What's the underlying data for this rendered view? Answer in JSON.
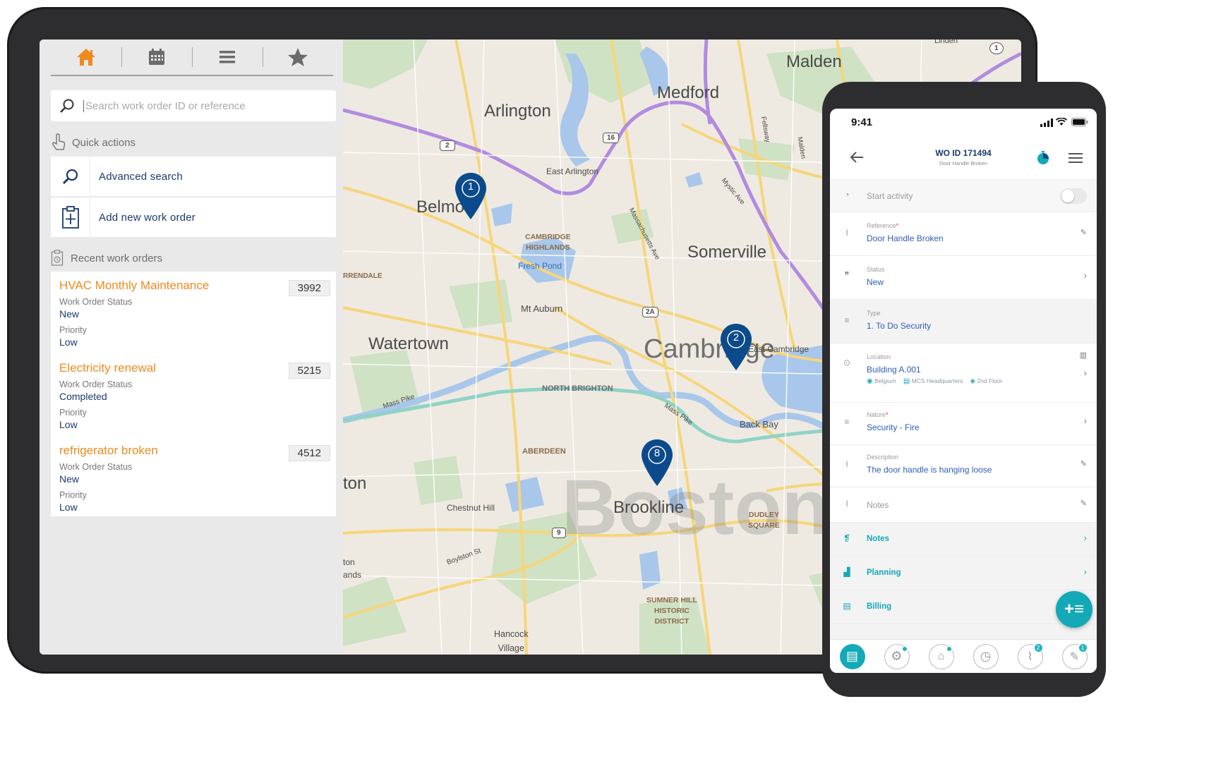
{
  "tablet": {
    "nav": {
      "home_icon": "home-icon",
      "calendar_icon": "calendar-icon",
      "menu_icon": "hamburger-icon",
      "favorites_icon": "star-icon",
      "accent": "#f08a1c"
    },
    "search": {
      "placeholder": "Search work order ID or reference"
    },
    "quick_actions": {
      "title": "Quick actions",
      "items": [
        {
          "label": "Advanced search",
          "icon": "search-icon"
        },
        {
          "label": "Add new work order",
          "icon": "clipboard-plus-icon"
        }
      ]
    },
    "recent": {
      "title": "Recent work orders",
      "status_label": "Work Order Status",
      "priority_label": "Priority",
      "items": [
        {
          "title": "HVAC Monthly Maintenance",
          "id": "3992",
          "status": "New",
          "priority": "Low"
        },
        {
          "title": "Electricity renewal",
          "id": "5215",
          "status": "Completed",
          "priority": "Low"
        },
        {
          "title": "refrigerator broken",
          "id": "4512",
          "status": "New",
          "priority": "Low"
        }
      ]
    },
    "map": {
      "labels": {
        "malden": "Malden",
        "medford": "Medford",
        "arlington": "Arlington",
        "east_arlington": "East Arlington",
        "belmont": "Belmo",
        "cambridge_highlands": "CAMBRIDGE\nHIGHLANDS",
        "fresh_pond": "Fresh Pond",
        "somerville": "Somerville",
        "mt_auburn": "Mt Auburn",
        "watertown": "Watertown",
        "cambridge": "Cambridge",
        "east_cambridge": "East Cambridge",
        "north_brighton": "NORTH BRIGHTON",
        "mass_pike": "Mass Pike",
        "mass_pike2": "Mass Pike",
        "back_bay": "Back Bay",
        "aberdeen": "ABERDEEN",
        "brookline": "Brookline",
        "boston": "Boston",
        "chestnut_hill": "Chestnut Hill",
        "dudley": "DUDLEY\nSQUARE",
        "boylston": "Boylston St",
        "sumner": "SUMNER HILL\nHISTORIC\nDISTRICT",
        "hancock": "Hancock\nVillage",
        "newton": "ton",
        "riverdale": "RRENDALE",
        "massachusetts_ave": "Massachusetts Ave",
        "mystic_ave": "Mystic Ave",
        "fellsway": "Fellsway",
        "malden_road": "Malden",
        "linden": "Linden",
        "lands": "ands",
        "newton2": "ton"
      },
      "route_badges": [
        "2",
        "16",
        "2A",
        "9",
        "1"
      ],
      "pins": [
        {
          "number": "1"
        },
        {
          "number": "2"
        },
        {
          "number": "8"
        }
      ],
      "pin_color": "#0b4a8b"
    }
  },
  "phone": {
    "time": "9:41",
    "header": {
      "title": "WO ID 171494",
      "subtitle": "Door Handle Broken"
    },
    "start_activity": "Start activity",
    "fields": {
      "reference": {
        "label": "Reference",
        "value": "Door Handle Broken"
      },
      "status": {
        "label": "Status",
        "value": "New"
      },
      "type": {
        "label": "Type",
        "value": "1. To Do Security"
      },
      "location": {
        "label": "Location",
        "value": "Building A.001",
        "crumbs": [
          "Belgium",
          "MCS Headquarters",
          "2nd Floor"
        ]
      },
      "nature": {
        "label": "Nature",
        "value": "Security - Fire"
      },
      "description": {
        "label": "Description",
        "value": "The door handle is hanging loose"
      },
      "notes_field": {
        "label": "Notes"
      }
    },
    "sections": {
      "notes": "Notes",
      "planning": "Planning",
      "billing": "Billing"
    },
    "bottom_nav": {
      "badge_attach": "2",
      "badge_edit": "1"
    },
    "accent": "#14a9b6"
  }
}
